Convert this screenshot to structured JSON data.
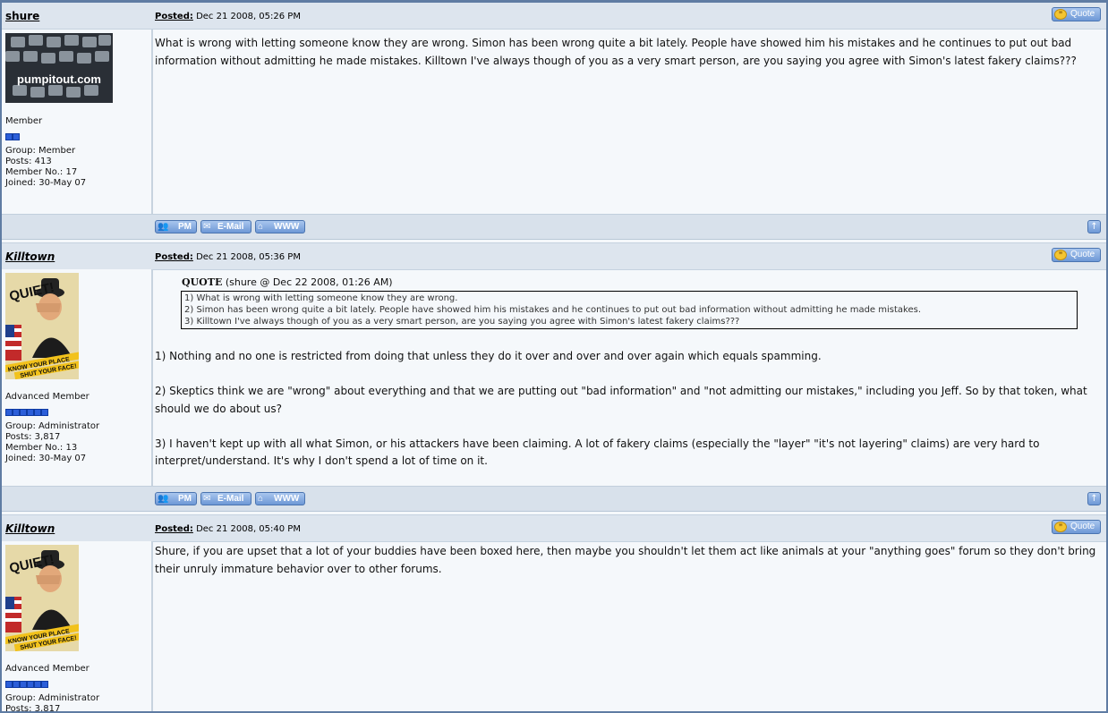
{
  "posts": [
    {
      "author": "shure",
      "avatar_text": "pumpitout.com",
      "posted_label": "Posted:",
      "posted_date": "Dec 21 2008, 05:26 PM",
      "quote_label": "Quote",
      "rank": "Member",
      "pips": 2,
      "group": "Group: Member",
      "posts": "Posts: 413",
      "member_no": "Member No.: 17",
      "joined": "Joined: 30-May 07",
      "paragraphs": [
        "What is wrong with letting someone know they are wrong. Simon has been wrong quite a bit lately. People have showed him his mistakes and he continues to put out bad information without admitting he made mistakes. Killtown I've always though of you as a very smart person, are you saying you agree with Simon's latest fakery claims???"
      ],
      "buttons": {
        "pm": "PM",
        "email": "E-Mail",
        "www": "WWW"
      }
    },
    {
      "author": "Killtown",
      "avatar_text": "QUIET!",
      "avatar_banner1": "KNOW YOUR PLACE",
      "avatar_banner2": "SHUT YOUR FACE!",
      "posted_label": "Posted:",
      "posted_date": "Dec 21 2008, 05:36 PM",
      "quote_label": "Quote",
      "rank": "Advanced Member",
      "pips": 6,
      "group": "Group: Administrator",
      "posts": "Posts: 3,817",
      "member_no": "Member No.: 13",
      "joined": "Joined: 30-May 07",
      "quote_title": "QUOTE",
      "quote_source": "(shure @ Dec 22 2008, 01:26 AM)",
      "quote_lines": [
        "1) What is wrong with letting someone know they are wrong.",
        "2) Simon has been wrong quite a bit lately.  People have showed him his mistakes and he continues to put out bad information without admitting he made mistakes.",
        "3) Killtown I've always though of you as a very smart person, are you saying you agree with Simon's latest fakery claims???"
      ],
      "paragraphs": [
        "1) Nothing and no one is restricted from doing that unless they do it over and over and over again which equals spamming.",
        "2) Skeptics think we are \"wrong\" about everything and that we are putting out \"bad information\" and \"not admitting our mistakes,\" including you Jeff. So by that token, what should we do about us?",
        "3) I haven't kept up with all what Simon, or his attackers have been claiming. A lot of fakery claims (especially the \"layer\" \"it's not layering\" claims) are very hard to interpret/understand. It's why I don't spend a lot of time on it."
      ],
      "buttons": {
        "pm": "PM",
        "email": "E-Mail",
        "www": "WWW"
      }
    },
    {
      "author": "Killtown",
      "avatar_text": "QUIET!",
      "avatar_banner1": "KNOW YOUR PLACE",
      "avatar_banner2": "SHUT YOUR FACE!",
      "posted_label": "Posted:",
      "posted_date": "Dec 21 2008, 05:40 PM",
      "quote_label": "Quote",
      "rank": "Advanced Member",
      "pips": 6,
      "group": "Group: Administrator",
      "posts": "Posts: 3,817",
      "paragraphs": [
        "Shure, if you are upset that a lot of your buddies have been boxed here, then maybe you shouldn't let them act like animals at your \"anything goes\" forum so they don't bring their unruly immature behavior over to other forums."
      ]
    }
  ],
  "colors": {
    "header_bg": "#dde5ee",
    "button_blue": "#6e98d6",
    "pip_blue": "#2b5ed9",
    "frame": "#5f7ca3"
  }
}
